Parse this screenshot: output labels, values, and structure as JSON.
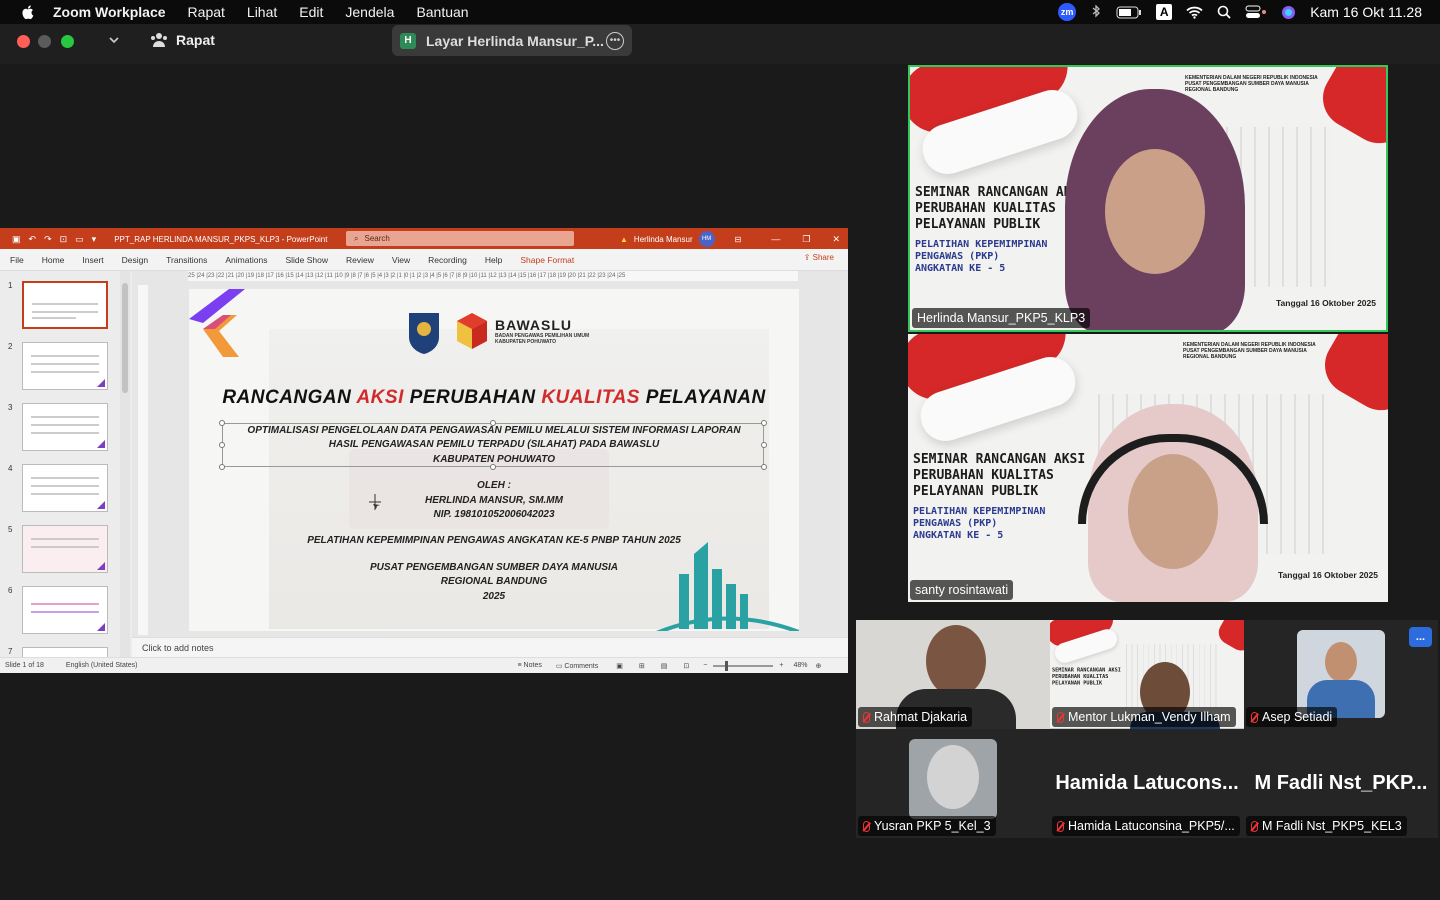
{
  "menubar": {
    "app_name": "Zoom Workplace",
    "items": [
      "Rapat",
      "Lihat",
      "Edit",
      "Jendela",
      "Bantuan"
    ],
    "clock": "Kam 16 Okt  11.28",
    "zm_label": "zm",
    "a_label": "A"
  },
  "zoom_window": {
    "meeting_label": "Rapat",
    "share_title": "Layar Herlinda Mansur_P...",
    "share_initial": "H"
  },
  "powerpoint": {
    "file_title": "PPT_RAP HERLINDA MANSUR_PKPS_KLP3  -  PowerPoint",
    "search_placeholder": "Search",
    "user_name": "Herlinda Mansur",
    "user_initials": "HM",
    "tabs": [
      "File",
      "Home",
      "Insert",
      "Design",
      "Transitions",
      "Animations",
      "Slide Show",
      "Review",
      "View",
      "Recording",
      "Help",
      "Shape Format"
    ],
    "share_label": "Share",
    "ruler_text": "25 |24 |23 |22 |21 |20 |19 |18 |17 |16 |15 |14 |13 |12 |11 |10 |9 |8 |7 |6 |5 |4 |3 |2 |1 |0 |1 |2 |3 |4 |5 |6 |7 |8 |9 |10 |11 |12 |13 |14 |15 |16 |17 |18 |19 |20 |21 |22 |23 |24 |25",
    "thumbnail_numbers": [
      "1",
      "2",
      "3",
      "4",
      "5",
      "6",
      "7"
    ],
    "notes_placeholder": "Click to add notes",
    "status": {
      "slide_info": "Slide 1 of 18",
      "language": "English (United States)",
      "notes": "Notes",
      "comments": "Comments",
      "zoom": "48%"
    },
    "slide": {
      "logo_word": "BAWASLU",
      "logo_sub1": "BADAN PENGAWAS PEMILIHAN UMUM",
      "logo_sub2": "KABUPATEN POHUWATO",
      "title_w1": "RANCANGAN",
      "title_w2": "AKSI",
      "title_w3": "PERUBAHAN",
      "title_w4": "KUALITAS",
      "title_w5": "PELAYANAN",
      "sub_line1": "OPTIMALISASI PENGELOLAAN DATA PENGAWASAN PEMILU MELALUI SISTEM INFORMASI LAPORAN",
      "sub_line2": "HASIL PENGAWASAN PEMILU TERPADU (SILAHAT) PADA BAWASLU",
      "sub_line3": "KABUPATEN POHUWATO",
      "oleh": "OLEH :",
      "author": "HERLINDA MANSUR, SM.MM",
      "nip": "NIP. 198101052006042023",
      "training": "PELATIHAN KEPEMIMPINAN PENGAWAS ANGKATAN KE-5 PNBP TAHUN 2025",
      "org1": "PUSAT PENGEMBANGAN SUMBER DAYA MANUSIA",
      "org2": "REGIONAL BANDUNG",
      "year": "2025"
    }
  },
  "virtual_background": {
    "seminar_l1": "SEMINAR RANCANGAN AKSI",
    "seminar_l2": "PERUBAHAN KUALITAS",
    "seminar_l3": "PELAYANAN PUBLIK",
    "pel_l1": "PELATIHAN KEPEMIMPINAN",
    "pel_l2": "PENGAWAS (PKP)",
    "pel_l3": "ANGKATAN KE - 5",
    "kem_l1": "KEMENTERIAN DALAM NEGERI REPUBLIK INDONESIA",
    "kem_l2": "PUSAT PENGEMBANGAN SUMBER DAYA MANUSIA",
    "kem_l3": "REGIONAL BANDUNG",
    "date": "Tanggal 16 Oktober 2025"
  },
  "participants": {
    "p1": "Herlinda Mansur_PKP5_KLP3",
    "p2": "santy rosintawati",
    "p3": "Rahmat Djakaria",
    "p4": "Mentor Lukman_Vendy Ilham",
    "p5": "Asep Setiadi",
    "p6": "Yusran PKP 5_Kel_3",
    "p7": "Hamida Latuconsina_PKP5/...",
    "p7_big": "Hamida Latucons...",
    "p8": "M Fadli Nst_PKP5_KEL3",
    "p8_big": "M Fadli Nst_PKP...",
    "more_label": "..."
  },
  "colors": {
    "ppt_accent": "#c43e1c",
    "active_speaker": "#35c759",
    "muted_red": "#e33333",
    "zoom_blue": "#2d6cdf"
  }
}
